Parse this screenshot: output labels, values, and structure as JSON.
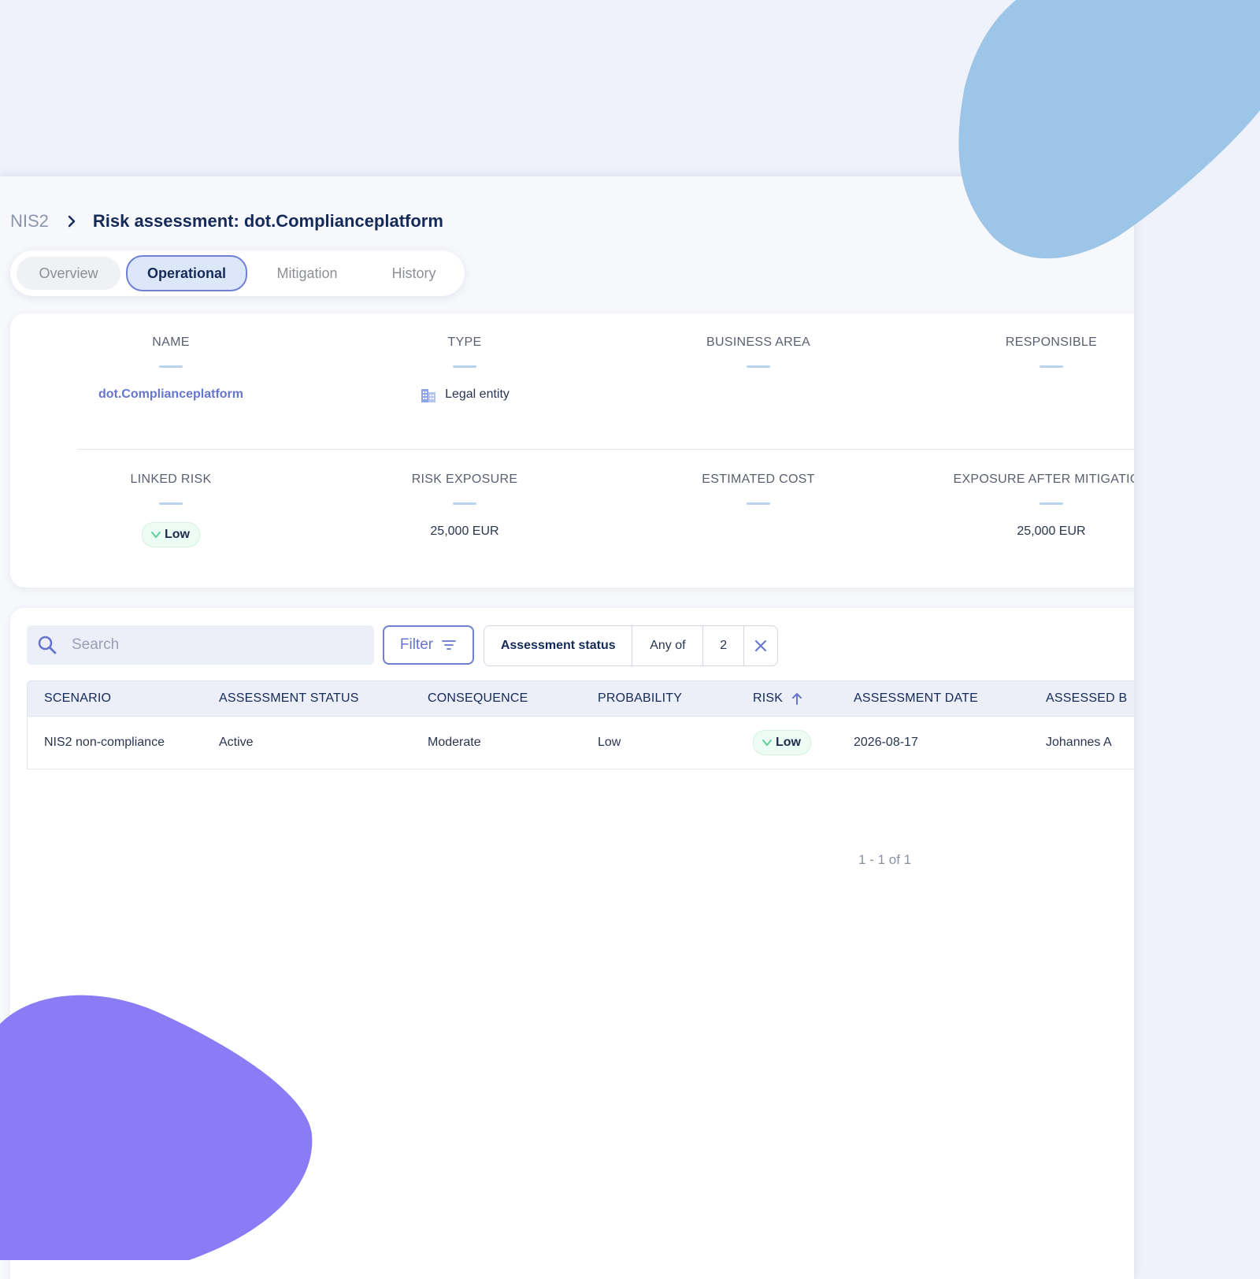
{
  "breadcrumb": {
    "root": "NIS2",
    "title": "Risk assessment: dot.Complianceplatform"
  },
  "tabs": [
    {
      "label": "Overview",
      "active": false
    },
    {
      "label": "Operational",
      "active": true
    },
    {
      "label": "Mitigation",
      "active": false
    },
    {
      "label": "History",
      "active": false
    }
  ],
  "info": {
    "name": {
      "label": "NAME",
      "value": "dot.Complianceplatform"
    },
    "type": {
      "label": "TYPE",
      "value": "Legal entity",
      "icon": "building-icon"
    },
    "business_area": {
      "label": "BUSINESS AREA",
      "value": ""
    },
    "responsible": {
      "label": "RESPONSIBLE",
      "value": ""
    },
    "linked_risk": {
      "label": "LINKED RISK",
      "value": "Low"
    },
    "risk_exposure": {
      "label": "RISK EXPOSURE",
      "value": "25,000 EUR"
    },
    "estimated_cost": {
      "label": "ESTIMATED COST",
      "value": ""
    },
    "exposure_after_mitigation": {
      "label": "EXPOSURE AFTER MITIGATION",
      "value": "25,000 EUR"
    }
  },
  "toolbar": {
    "search_placeholder": "Search",
    "filter_label": "Filter",
    "chip": {
      "label": "Assessment status",
      "operator": "Any of",
      "count": "2"
    }
  },
  "table": {
    "columns": [
      "SCENARIO",
      "ASSESSMENT STATUS",
      "CONSEQUENCE",
      "PROBABILITY",
      "RISK",
      "ASSESSMENT DATE",
      "ASSESSED B"
    ],
    "rows": [
      {
        "scenario": "NIS2 non-compliance",
        "status": "Active",
        "consequence": "Moderate",
        "probability": "Low",
        "risk": "Low",
        "date": "2026-08-17",
        "assessed_by": "Johannes A"
      }
    ],
    "pagination": "1 - 1 of 1"
  },
  "colors": {
    "accent": "#6f7fd6",
    "title": "#142a58",
    "low_badge_bg": "#ecfbf3",
    "low_chevron": "#5ccf9a",
    "blob_blue": "#9cc5e8",
    "blob_purple": "#8b7cf6"
  }
}
